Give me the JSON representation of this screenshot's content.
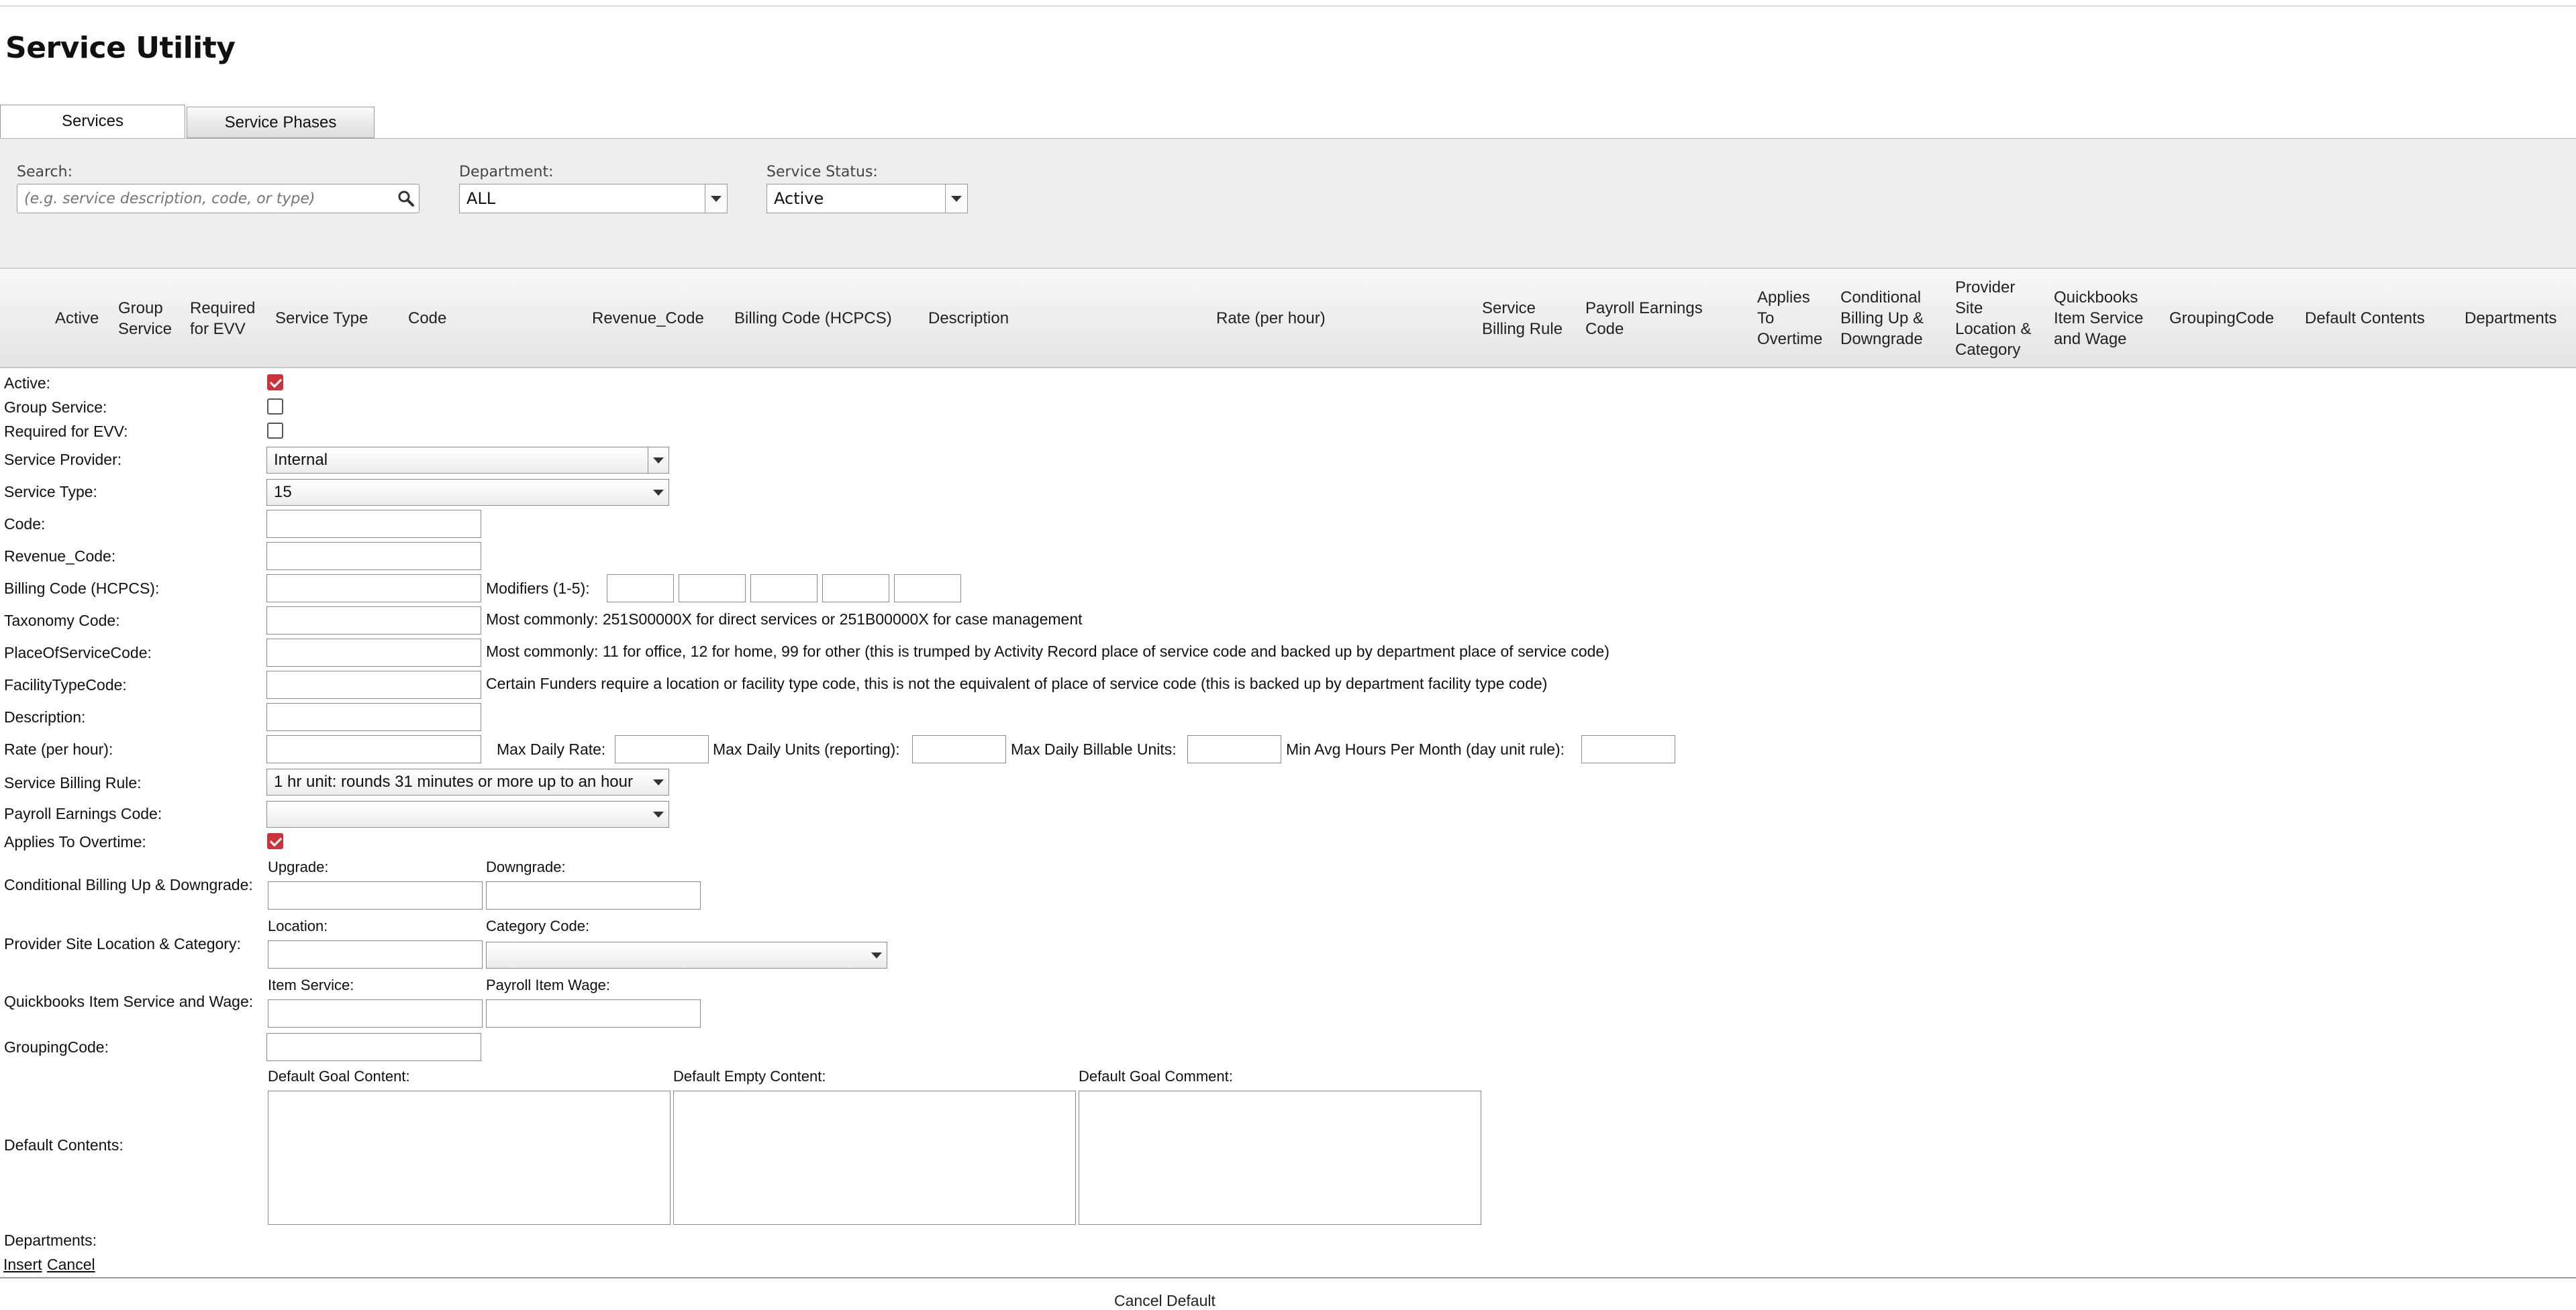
{
  "page": {
    "title": "Service Utility"
  },
  "tabs": [
    {
      "label": "Services"
    },
    {
      "label": "Service Phases"
    }
  ],
  "filters": {
    "search_label": "Search:",
    "search_placeholder": "(e.g. service description, code, or type)",
    "department_label": "Department:",
    "department_value": "ALL",
    "status_label": "Service Status:",
    "status_value": "Active"
  },
  "grid_columns": [
    "Active",
    "Group Service",
    "Required for EVV",
    "Service Type",
    "Code",
    "Revenue_Code",
    "Billing Code (HCPCS)",
    "Description",
    "Rate (per hour)",
    "Service Billing Rule",
    "Payroll Earnings Code",
    "Applies To Overtime",
    "Conditional Billing Up & Downgrade",
    "Provider Site Location & Category",
    "Quickbooks Item Service and Wage",
    "GroupingCode",
    "Default Contents",
    "Departments"
  ],
  "form": {
    "active_label": "Active:",
    "group_service_label": "Group Service:",
    "required_evv_label": "Required for EVV:",
    "service_provider_label": "Service Provider:",
    "service_provider_value": "Internal",
    "service_type_label": "Service Type:",
    "service_type_value": "15",
    "code_label": "Code:",
    "revenue_code_label": "Revenue_Code:",
    "billing_code_label": "Billing Code (HCPCS):",
    "modifiers_label": "Modifiers (1-5):",
    "taxonomy_label": "Taxonomy Code:",
    "taxonomy_note": "Most commonly: 251S00000X for direct services or 251B00000X for case management",
    "pos_label": "PlaceOfServiceCode:",
    "pos_note": "Most commonly: 11 for office, 12 for home, 99 for other (this is trumped by Activity Record place of service code and backed up by department place of service code)",
    "facility_label": "FacilityTypeCode:",
    "facility_note": "Certain Funders require a location or facility type code, this is not the equivalent of place of service code (this is backed up by department facility type code)",
    "description_label": "Description:",
    "rate_label": "Rate (per hour):",
    "max_daily_rate_label": "Max Daily Rate:",
    "max_daily_units_label": "Max Daily Units (reporting):",
    "max_daily_billable_label": "Max Daily Billable Units:",
    "min_avg_hours_label": "Min Avg Hours Per Month (day unit rule):",
    "billing_rule_label": "Service Billing Rule:",
    "billing_rule_value": "1 hr unit: rounds 31 minutes or more up to an hour",
    "payroll_label": "Payroll Earnings Code:",
    "payroll_value": "",
    "overtime_label": "Applies To Overtime:",
    "cond_label": "Conditional Billing Up & Downgrade:",
    "upgrade_label": "Upgrade:",
    "downgrade_label": "Downgrade:",
    "provider_site_label": "Provider Site Location & Category:",
    "location_label": "Location:",
    "category_label": "Category Code:",
    "category_value": "",
    "qb_label": "Quickbooks Item Service and Wage:",
    "item_service_label": "Item Service:",
    "payroll_item_label": "Payroll Item Wage:",
    "grouping_label": "GroupingCode:",
    "default_contents_label": "Default Contents:",
    "default_goal_content_label": "Default Goal Content:",
    "default_empty_content_label": "Default Empty Content:",
    "default_goal_comment_label": "Default Goal Comment:",
    "departments_label": "Departments:",
    "insert_label": "Insert",
    "cancel_label": "Cancel",
    "active_checked": true,
    "group_service_checked": false,
    "required_evv_checked": false,
    "overtime_checked": true
  },
  "footer": {
    "partial_text": "Cancel Default"
  },
  "colors": {
    "checkbox_accent": "#c9343a",
    "filter_bg": "#eeeeee"
  }
}
